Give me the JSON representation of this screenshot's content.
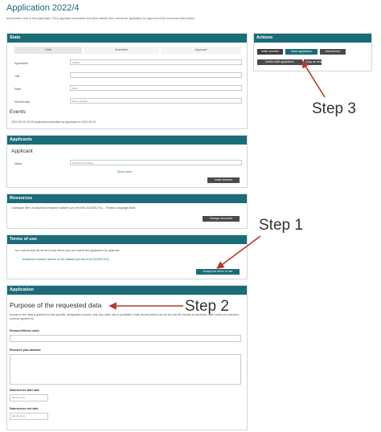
{
  "page": {
    "title": "Application 2022/4",
    "intro": "Anonymised view of this application. Fill in applicant information and other details, then submit the application for approval of the resources listed below."
  },
  "state": {
    "header": "State",
    "tabs": [
      "Draft",
      "Submitted",
      "Approved"
    ],
    "fields": [
      {
        "label": "Application",
        "value": "2022/4"
      },
      {
        "label": "Title",
        "value": ""
      },
      {
        "label": "State",
        "value": "Draft"
      },
      {
        "label": "Membership",
        "value": "Not a member"
      }
    ],
    "events_title": "Events",
    "event": "2022-05-20 15:40   Application submitted by Applicant on 2022-05-20"
  },
  "actions": {
    "header": "Actions",
    "buttons": [
      "Invite member",
      "Save application",
      "Submit form",
      "Delete draft application",
      "Copy as new"
    ]
  },
  "applicants": {
    "header": "Applicants",
    "subheader": "Applicant",
    "name_label": "Name",
    "name_value": "Firstname Surname",
    "show_more": "Show more",
    "add_member": "Invite member"
  },
  "resources": {
    "header": "Resources",
    "line": "Catalogue item: Anonymised research dataset (urn:nbn:fi:lb-2022051701) – Finnish Language Bank",
    "button": "Change resources"
  },
  "terms": {
    "header": "Terms of use",
    "line1": "You must accept the terms of use before you can submit the application for approval.",
    "line2": "Academic research license for the dataset (urn:nbn:fi:lb-2022051701)",
    "button": "Accept the terms of use"
  },
  "application": {
    "header": "Application",
    "section_title": "Purpose of the requested data",
    "description": "Access to the data is granted for this specific, designated purpose only. Any other use is prohibited. Data access period can be at most 48 months at maximum, after which an extension must be applied for.",
    "fields": [
      {
        "label": "Research/thesis name",
        "placeholder": ""
      },
      {
        "label": "Research plan abstract",
        "placeholder": ""
      },
      {
        "label": "Data access start date",
        "placeholder": "dd.mm.yyyy"
      },
      {
        "label": "Data access end date",
        "placeholder": "dd.mm.yyyy"
      }
    ]
  },
  "annotations": {
    "step1": "Step 1",
    "step2": "Step 2",
    "step3": "Step 3",
    "arrow_color": "#b33a2a"
  },
  "colors": {
    "accent": "#1b6b78",
    "button_dark": "#4a4a4a"
  }
}
